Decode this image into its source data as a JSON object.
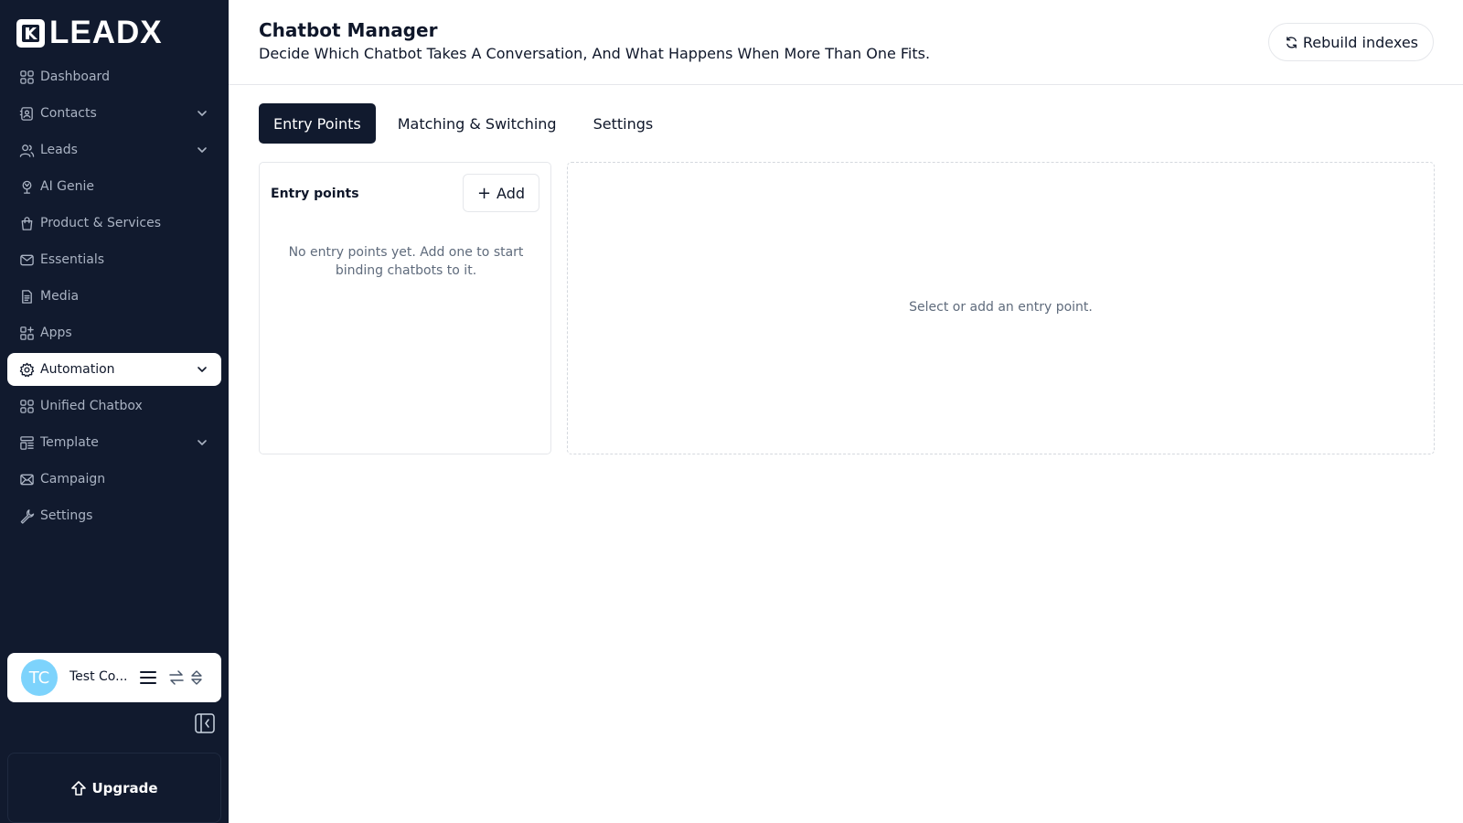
{
  "brand": {
    "name": "LEADX"
  },
  "sidebar": {
    "items": [
      {
        "label": "Dashboard",
        "icon": "grid-icon",
        "has_chevron": false,
        "active": false
      },
      {
        "label": "Contacts",
        "icon": "contact-card-icon",
        "has_chevron": true,
        "active": false
      },
      {
        "label": "Leads",
        "icon": "users-icon",
        "has_chevron": true,
        "active": false
      },
      {
        "label": "AI Genie",
        "icon": "ai-brain-icon",
        "has_chevron": false,
        "active": false
      },
      {
        "label": "Product & Services",
        "icon": "shopping-bag-icon",
        "has_chevron": false,
        "active": false
      },
      {
        "label": "Essentials",
        "icon": "mail-icon",
        "has_chevron": false,
        "active": false
      },
      {
        "label": "Media",
        "icon": "file-icon",
        "has_chevron": false,
        "active": false
      },
      {
        "label": "Apps",
        "icon": "apps-icon",
        "has_chevron": false,
        "active": false
      },
      {
        "label": "Automation",
        "icon": "gear-icon",
        "has_chevron": true,
        "active": true
      },
      {
        "label": "Unified Chatbox",
        "icon": "grid-icon",
        "has_chevron": false,
        "active": false
      },
      {
        "label": "Template",
        "icon": "template-icon",
        "has_chevron": true,
        "active": false
      },
      {
        "label": "Campaign",
        "icon": "campaign-mail-icon",
        "has_chevron": false,
        "active": false
      },
      {
        "label": "Settings",
        "icon": "wrench-icon",
        "has_chevron": false,
        "active": false
      }
    ],
    "workspace": {
      "initials": "TC",
      "name": "Test Co..."
    },
    "upgrade_label": "Upgrade"
  },
  "header": {
    "title": "Chatbot Manager",
    "subtitle": "Decide Which Chatbot Takes A Conversation, And What Happens When More Than One Fits.",
    "rebuild_label": "Rebuild indexes"
  },
  "tabs": [
    {
      "label": "Entry Points",
      "active": true
    },
    {
      "label": "Matching & Switching",
      "active": false
    },
    {
      "label": "Settings",
      "active": false
    }
  ],
  "entry_points": {
    "title": "Entry points",
    "add_label": "Add",
    "empty_text": "No entry points yet. Add one to start binding chatbots to it."
  },
  "detail": {
    "empty_text": "Select or add an entry point."
  },
  "colors": {
    "sidebar_bg": "#111a2e",
    "sidebar_text": "#aab3c3",
    "avatar": "#7dd3fc",
    "active_tab": "#111a2e",
    "border": "#e5e7eb"
  }
}
